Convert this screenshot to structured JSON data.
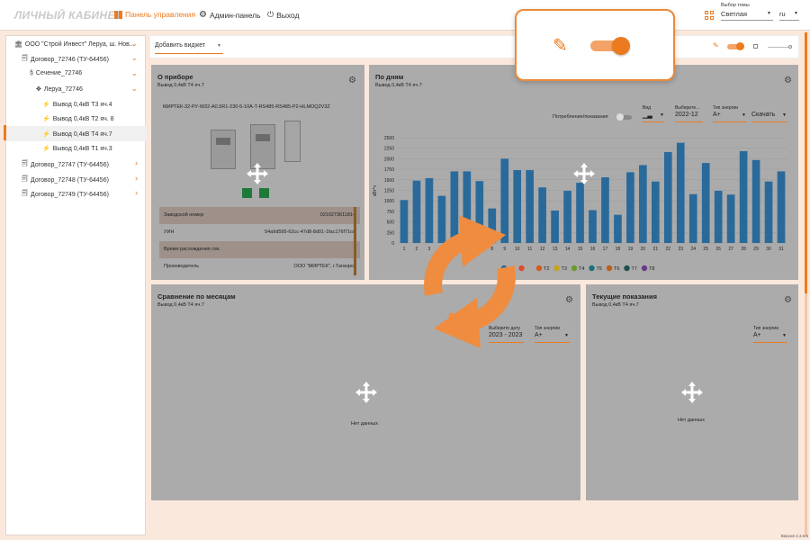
{
  "header": {
    "logo": "ЛИЧНЫЙ КАБИНЕТ",
    "nav": [
      {
        "label": "Панель управления",
        "icon": "dashboard-icon",
        "active": true
      },
      {
        "label": "Админ-панель",
        "icon": "gear-icon",
        "active": false
      },
      {
        "label": "Выход",
        "icon": "power-icon",
        "active": false
      }
    ],
    "theme_label": "Выбор темы",
    "theme_value": "Светлая",
    "lang_value": "ru"
  },
  "sidebar": {
    "items": [
      {
        "label": "ООО \"Строй Инвест\" Леруа, ш. Нов...",
        "icon": "building-icon"
      },
      {
        "label": "Договор_72746 (ТУ-64456)",
        "icon": "document-icon"
      },
      {
        "label": "Сечение_72746",
        "icon": "section-icon"
      },
      {
        "label": "Леруа_72746",
        "icon": "node-icon"
      },
      {
        "label": "Вывод 0,4кВ Т3 яч.4",
        "icon": "meter-icon"
      },
      {
        "label": "Вывод 0,4кВ Т2 яч. 8",
        "icon": "meter-icon"
      },
      {
        "label": "Вывод 0,4кВ Т4 яч.7",
        "icon": "meter-icon"
      },
      {
        "label": "Вывод 0,4кВ Т1 яч.3",
        "icon": "meter-icon"
      },
      {
        "label": "Договор_72747 (ТУ-64456)",
        "icon": "document-icon"
      },
      {
        "label": "Договор_72748 (ТУ-64456)",
        "icon": "document-icon"
      },
      {
        "label": "Договор_72749 (ТУ-64456)",
        "icon": "document-icon"
      }
    ]
  },
  "toolbar": {
    "add_widget_label": "Добавить виджет"
  },
  "device_widget": {
    "title": "О приборе",
    "subtitle": "Вывод 0,4кВ Т4 яч.7",
    "model": "МИРТЕК-32-РУ-W32-A0.5R1-230-5-10A-T-RS485-RS485-P2-HLMOQ2V3Z",
    "rows": [
      {
        "key": "Заводской номер",
        "value": "0210273611814"
      },
      {
        "key": "УИН",
        "value": "54a9d595-62cc-47d8-8d01-1fac176f71ce"
      },
      {
        "key": "Время расхождения сек.",
        "value": "-"
      },
      {
        "key": "Производитель",
        "value": "ООО \"МИРТЕК\", г.Таганрог"
      }
    ]
  },
  "days_widget": {
    "title": "По дням",
    "subtitle": "Вывод 0,4кВ Т4 яч.7",
    "toggle_label": "Потребление/показания",
    "view_label": "Вид",
    "date_label": "Выберите...",
    "date_value": "2022-12",
    "energy_label": "Тип энергии",
    "energy_value": "A+",
    "download_label": "Скачать"
  },
  "months_widget": {
    "title": "Сравнение по месяцам",
    "subtitle": "Вывод 0,4кВ Т4 яч.7",
    "date_label": "Выберите дату",
    "date_value": "2023 - 2023",
    "energy_label": "Тип энергии",
    "energy_value": "A+",
    "no_data": "Нет данных"
  },
  "current_widget": {
    "title": "Текущие показания",
    "subtitle": "Вывод 0,4кВ Т4 яч.7",
    "energy_label": "Тип энергии",
    "energy_value": "A+",
    "no_data": "Нет данных"
  },
  "version": "Версия 2.3.6.5",
  "colors": {
    "accent": "#ec7b1f",
    "bar": "#2a6a9b",
    "overlay": "#ababab"
  },
  "chart_data": {
    "type": "bar",
    "ylabel": "кВт*ч",
    "ylim": [
      0,
      2500
    ],
    "yticks": [
      0,
      250,
      500,
      750,
      1000,
      1250,
      1500,
      1750,
      2000,
      2250,
      2500
    ],
    "categories": [
      "1",
      "2",
      "3",
      "4",
      "5",
      "6",
      "7",
      "8",
      "9",
      "10",
      "11",
      "12",
      "13",
      "14",
      "15",
      "16",
      "17",
      "18",
      "19",
      "20",
      "21",
      "22",
      "23",
      "24",
      "25",
      "26",
      "27",
      "28",
      "29",
      "30",
      "31"
    ],
    "values": [
      1020,
      1480,
      1540,
      1120,
      1700,
      1700,
      1470,
      820,
      2000,
      1730,
      1730,
      1320,
      770,
      1240,
      1430,
      780,
      1560,
      670,
      1680,
      1850,
      1460,
      2160,
      2380,
      1160,
      1900,
      1240,
      1150,
      2180,
      1970,
      1460,
      1700
    ],
    "legend": [
      {
        "name": "",
        "color": "#2a6a9b"
      },
      {
        "name": "",
        "color": "#e14a2a"
      },
      {
        "name": "T2",
        "color": "#d45a1a"
      },
      {
        "name": "T3",
        "color": "#c8a21a"
      },
      {
        "name": "T4",
        "color": "#6b9c2a"
      },
      {
        "name": "T5",
        "color": "#1c6f7d"
      },
      {
        "name": "T6",
        "color": "#b8601a"
      },
      {
        "name": "T7",
        "color": "#1f4f4f"
      },
      {
        "name": "T8",
        "color": "#6a3a8a"
      }
    ]
  }
}
